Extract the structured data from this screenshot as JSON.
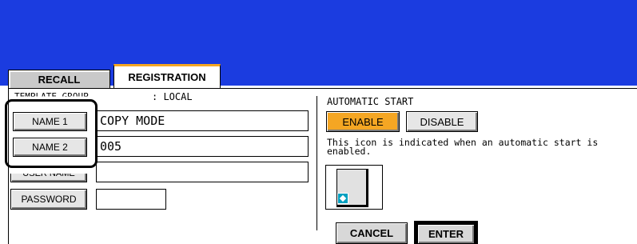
{
  "tabs": [
    {
      "label": "RECALL",
      "active": false
    },
    {
      "label": "REGISTRATION",
      "active": true
    }
  ],
  "template_group": {
    "label": "TEMPLATE GROUP",
    "value": ": LOCAL"
  },
  "fields": {
    "name1": {
      "button_label": "NAME 1",
      "value": "COPY MODE"
    },
    "name2": {
      "button_label": "NAME 2",
      "value": "005"
    },
    "user_name": {
      "button_label": "USER NAME",
      "value": ""
    },
    "password": {
      "button_label": "PASSWORD",
      "value": ""
    }
  },
  "automatic_start": {
    "title": "AUTOMATIC START",
    "enable_label": "ENABLE",
    "disable_label": "DISABLE",
    "selected": "ENABLE",
    "description": "This icon is indicated when an automatic start is enabled."
  },
  "actions": {
    "cancel_label": "CANCEL",
    "enter_label": "ENTER"
  },
  "colors": {
    "header": "#1b3ce0",
    "accent": "#f5a623",
    "button_face": "#e6e6e6",
    "icon_start": "#00a0c0"
  },
  "icons": [
    "start-diamond-icon"
  ]
}
